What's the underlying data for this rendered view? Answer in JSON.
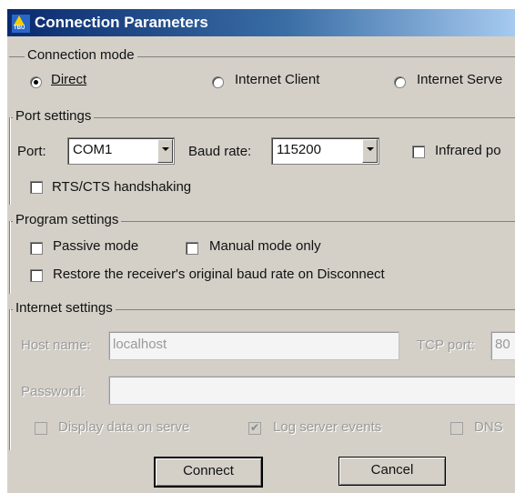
{
  "window": {
    "title": "Connection Parameters",
    "icon": "app-icon",
    "icon_text": "TBU"
  },
  "connection_mode": {
    "legend": "Connection mode",
    "options": [
      {
        "label": "Direct",
        "selected": true
      },
      {
        "label": "Internet Client",
        "selected": false
      },
      {
        "label": "Internet Serve",
        "selected": false
      }
    ]
  },
  "port_settings": {
    "legend": "Port settings",
    "port_label": "Port:",
    "port_value": "COM1",
    "baud_label": "Baud rate:",
    "baud_value": "115200",
    "infrared_label": "Infrared po",
    "infrared_checked": false,
    "rts_label": "RTS/CTS handshaking",
    "rts_checked": false
  },
  "program_settings": {
    "legend": "Program settings",
    "passive_label": "Passive mode",
    "passive_checked": false,
    "manual_label": "Manual mode only",
    "manual_checked": false,
    "restore_label": "Restore the receiver's original baud rate on Disconnect",
    "restore_checked": false
  },
  "internet_settings": {
    "legend": "Internet settings",
    "host_label": "Host name:",
    "host_value": "localhost",
    "tcp_label": "TCP port:",
    "tcp_value": "80",
    "password_label": "Password:",
    "password_value": "",
    "display_label": "Display data on serve",
    "display_checked": false,
    "log_label": "Log server events",
    "log_checked": true,
    "dns_label": "DNS"
  },
  "buttons": {
    "connect": "Connect",
    "cancel": "Cancel"
  },
  "colors": {
    "face": "#d4d0c8",
    "title_start": "#0a2a6e",
    "title_end": "#a6caf0",
    "disabled_text": "#9a9a9a"
  }
}
